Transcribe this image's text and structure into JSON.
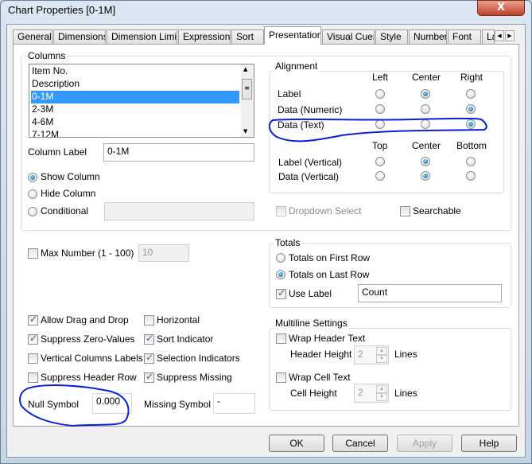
{
  "window": {
    "title": "Chart Properties [0-1M]",
    "close": "X"
  },
  "tabs": [
    "General",
    "Dimensions",
    "Dimension Limits",
    "Expressions",
    "Sort",
    "Presentation",
    "Visual Cues",
    "Style",
    "Number",
    "Font",
    "La"
  ],
  "active_tab": "Presentation",
  "columns": {
    "title": "Columns",
    "items": [
      "Item No.",
      "Description",
      "0-1M",
      "2-3M",
      "4-6M",
      "7-12M"
    ],
    "selected": "0-1M",
    "column_label": "Column Label",
    "column_label_value": "0-1M",
    "show": "Show Column",
    "hide": "Hide Column",
    "conditional": "Conditional",
    "visibility": "Show Column"
  },
  "alignment": {
    "title": "Alignment",
    "h_headers": [
      "Left",
      "Center",
      "Right"
    ],
    "v_headers": [
      "Top",
      "Center",
      "Bottom"
    ],
    "rows": [
      {
        "label": "Label",
        "selected": "Center"
      },
      {
        "label": "Data (Numeric)",
        "selected": "Right"
      },
      {
        "label": "Data (Text)",
        "selected": "Right"
      }
    ],
    "vrows": [
      {
        "label": "Label (Vertical)",
        "selected": "Center"
      },
      {
        "label": "Data (Vertical)",
        "selected": "Center"
      }
    ]
  },
  "dropdown_select": {
    "label": "Dropdown Select",
    "checked": false,
    "disabled": true
  },
  "searchable": {
    "label": "Searchable",
    "checked": false
  },
  "max_number": {
    "label": "Max Number (1 - 100)",
    "checked": false,
    "value": "10"
  },
  "totals": {
    "title": "Totals",
    "first": "Totals on First Row",
    "last": "Totals on Last Row",
    "selected": "Totals on Last Row",
    "use_label": "Use Label",
    "use_label_checked": true,
    "label_value": "Count"
  },
  "options": [
    {
      "label": "Allow Drag and Drop",
      "checked": true
    },
    {
      "label": "Suppress Zero-Values",
      "checked": true
    },
    {
      "label": "Vertical Columns Labels",
      "checked": false
    },
    {
      "label": "Suppress Header Row",
      "checked": false
    },
    {
      "label": "Horizontal",
      "checked": false
    },
    {
      "label": "Sort Indicator",
      "checked": true
    },
    {
      "label": "Selection Indicators",
      "checked": true
    },
    {
      "label": "Suppress Missing",
      "checked": true
    }
  ],
  "null_symbol": {
    "label": "Null Symbol",
    "value": "0.000"
  },
  "missing_symbol": {
    "label": "Missing Symbol",
    "value": "-"
  },
  "multiline": {
    "title": "Multiline Settings",
    "wrap_header": "Wrap Header Text",
    "header_height": "Header Height",
    "header_value": "2",
    "wrap_cell": "Wrap Cell Text",
    "cell_height": "Cell Height",
    "cell_value": "2",
    "lines": "Lines"
  },
  "buttons": {
    "ok": "OK",
    "cancel": "Cancel",
    "apply": "Apply",
    "help": "Help"
  },
  "annotation_color": "#0a1fd6"
}
